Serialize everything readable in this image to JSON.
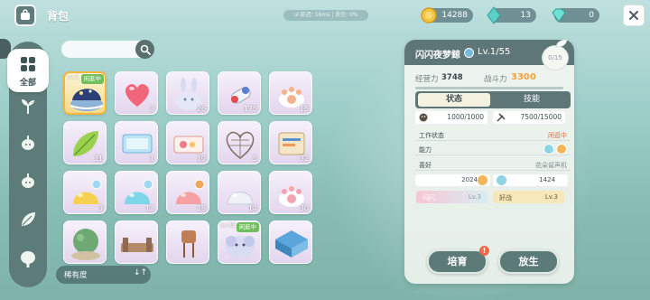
{
  "header": {
    "title": "背包",
    "net_info": "ul 延迟: 16ms | 丢包: 0%",
    "coins": "14288",
    "crystals": "13",
    "gems": "0"
  },
  "rail": {
    "active_label": "全部",
    "icons": [
      "grid-icon",
      "sprout-icon",
      "bulb-icon",
      "bulb-icon",
      "leaf-icon",
      "tree-icon"
    ]
  },
  "search": {
    "placeholder": ""
  },
  "grid": {
    "items": [
      {
        "name": "night-island",
        "count": "",
        "tag": "闲逛中",
        "level": "Lv.1",
        "selected": true
      },
      {
        "name": "heart-item",
        "count": "2"
      },
      {
        "name": "crystal-bunny",
        "count": "26"
      },
      {
        "name": "potion-bottle",
        "count": "175"
      },
      {
        "name": "paw-cushion",
        "count": "16"
      },
      {
        "name": "green-leaf",
        "count": "31"
      },
      {
        "name": "blue-ticket",
        "count": "1"
      },
      {
        "name": "flower-ticket",
        "count": "10"
      },
      {
        "name": "heart-net",
        "count": "5"
      },
      {
        "name": "scroll-pack",
        "count": "32"
      },
      {
        "name": "yellow-slime",
        "count": "3"
      },
      {
        "name": "blue-slime",
        "count": "12"
      },
      {
        "name": "pink-slime",
        "count": "18"
      },
      {
        "name": "clear-slime",
        "count": "14"
      },
      {
        "name": "paw-cushion-2",
        "count": "30"
      },
      {
        "name": "round-tree",
        "count": ""
      },
      {
        "name": "bed-frame",
        "count": ""
      },
      {
        "name": "water-tower",
        "count": ""
      },
      {
        "name": "elephant",
        "count": "",
        "tag": "闲逛中",
        "level": "Lv.45"
      },
      {
        "name": "blue-tile",
        "count": ""
      }
    ]
  },
  "sort": {
    "label": "稀有度",
    "arrow": "↓↑"
  },
  "panel": {
    "name": "闪闪夜梦鲸",
    "level": "Lv.1/55",
    "exp_badge": "0/15",
    "exp_label": "经营力",
    "exp_value": "3748",
    "power_label": "战斗力",
    "power_value": "3300",
    "tab_status": "状态",
    "tab_skills": "技能",
    "mood": "1000/1000",
    "energy": "7500/15000",
    "work_label": "工作状态",
    "work_value": "闲逛中",
    "ability_label": "能力",
    "like_label": "喜好",
    "like_value": "花朵留声机",
    "pref1": "2024",
    "pref2": "1424",
    "skill1_label": "闪闪",
    "skill1_level": "Lv.3",
    "skill2_label": "好战",
    "skill2_level": "Lv.3",
    "btn_cultivate": "培育",
    "btn_release": "放生",
    "notice_badge": "!"
  }
}
